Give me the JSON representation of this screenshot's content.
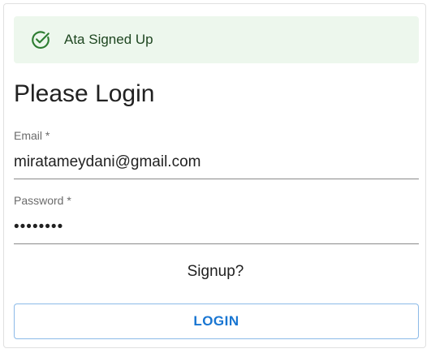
{
  "alert": {
    "message": "Ata Signed Up",
    "icon": "check-circle-icon",
    "background": "#edf7ed",
    "icon_color": "#2e7d32"
  },
  "form": {
    "title": "Please Login",
    "email": {
      "label": "Email *",
      "value": "miratameydani@gmail.com"
    },
    "password": {
      "label": "Password *",
      "value": "••••••••"
    },
    "signup_link": "Signup?",
    "login_button": "LOGIN",
    "accent_color": "#1976d2"
  }
}
